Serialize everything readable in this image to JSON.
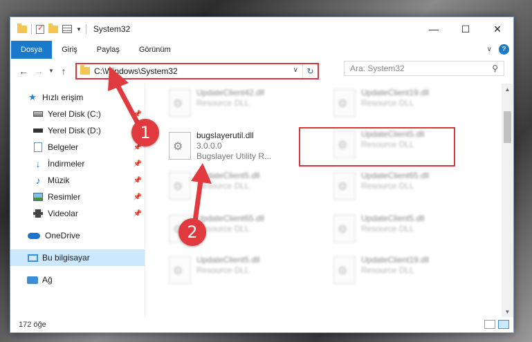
{
  "window": {
    "title": "System32",
    "controls": {
      "minimize": "—",
      "maximize": "☐",
      "close": "✕"
    }
  },
  "ribbon": {
    "tabs": [
      "Dosya",
      "Giriş",
      "Paylaş",
      "Görünüm"
    ],
    "help": "?"
  },
  "address": {
    "path": "C:\\Windows\\System32",
    "search_placeholder": "Ara: System32"
  },
  "sidebar": {
    "items": [
      {
        "label": "Hızlı erişim",
        "icon": "star-icon"
      },
      {
        "label": "Yerel Disk (C:)",
        "icon": "drive-icon",
        "pinned": true
      },
      {
        "label": "Yerel Disk (D:)",
        "icon": "drive-icon",
        "pinned": true
      },
      {
        "label": "Belgeler",
        "icon": "document-icon",
        "pinned": true
      },
      {
        "label": "İndirmeler",
        "icon": "download-icon",
        "pinned": true
      },
      {
        "label": "Müzik",
        "icon": "music-icon",
        "pinned": true
      },
      {
        "label": "Resimler",
        "icon": "pictures-icon",
        "pinned": true
      },
      {
        "label": "Videolar",
        "icon": "videos-icon",
        "pinned": true
      },
      {
        "label": "OneDrive",
        "icon": "cloud-icon"
      },
      {
        "label": "Bu bilgisayar",
        "icon": "computer-icon",
        "selected": true
      },
      {
        "label": "Ağ",
        "icon": "network-icon"
      }
    ]
  },
  "files": {
    "selected": {
      "name": "bugslayerutil.dll",
      "version": "3.0.0.0",
      "desc": "Bugslayer Utility R..."
    },
    "left_col": [
      {
        "name": "UpdateClient42.dll",
        "type": "Resource DLL"
      },
      {
        "name": "UpdateClient5.dll",
        "type": "Resource DLL"
      },
      {
        "name": "UpdateClient65.dll",
        "type": "Resource DLL"
      },
      {
        "name": "UpdateClient5.dll",
        "type": "Resource DLL"
      }
    ],
    "right_col": [
      {
        "name": "UpdateClient19.dll",
        "type": "Resource DLL"
      },
      {
        "name": "UpdateClient5.dll",
        "type": "Resource DLL"
      },
      {
        "name": "UpdateClient65.dll",
        "type": "Resource DLL"
      },
      {
        "name": "UpdateClient5.dll",
        "type": "Resource DLL"
      },
      {
        "name": "UpdateClient19.dll",
        "type": "Resource DLL"
      }
    ]
  },
  "status": {
    "count": "172 öğe"
  },
  "annotations": {
    "step1": "1",
    "step2": "2"
  },
  "colors": {
    "accent": "#1979ca",
    "highlight": "#d9363e",
    "badge": "#e03a3e"
  }
}
